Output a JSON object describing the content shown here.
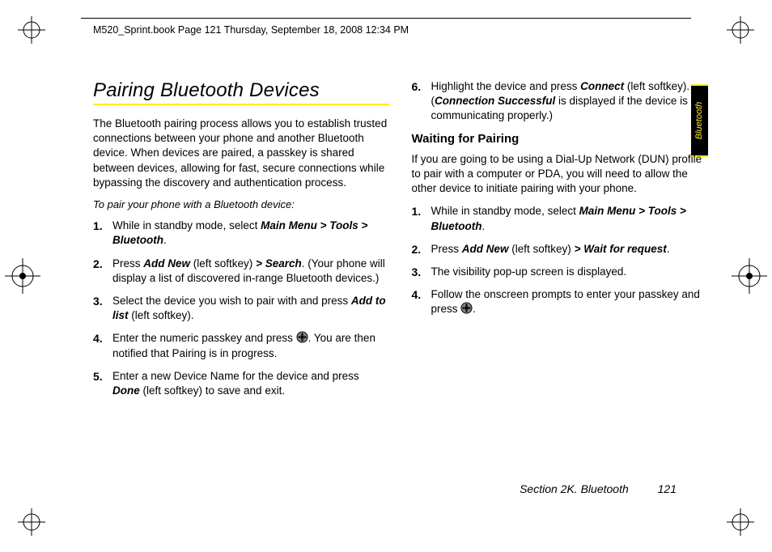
{
  "header": {
    "running": "M520_Sprint.book  Page 121  Thursday, September 18, 2008  12:34 PM"
  },
  "sideTab": {
    "label": "Bluetooth"
  },
  "left": {
    "title": "Pairing Bluetooth Devices",
    "intro": "The Bluetooth pairing process allows you to establish trusted connections between your phone and another Bluetooth device. When devices are paired, a passkey is shared between devices, allowing for fast, secure connections while bypassing the discovery and authentication process.",
    "lead": "To pair your phone with a Bluetooth device:",
    "steps": {
      "s1a": "While in standby mode, select ",
      "s1b": "Main Menu > Tools > Bluetooth",
      "s1c": ".",
      "s2a": "Press ",
      "s2b": "Add New",
      "s2c": " (left softkey) ",
      "s2d": "> Search",
      "s2e": ". (Your phone will display a list of discovered in-range Bluetooth devices.)",
      "s3a": "Select the device you wish to pair with and press ",
      "s3b": "Add to list",
      "s3c": " (left softkey).",
      "s4a": "Enter the numeric passkey and press ",
      "s4b": ". You are then notified that Pairing is in progress.",
      "s5a": "Enter a new Device Name for the device and press ",
      "s5b": "Done",
      "s5c": " (left softkey) to save and exit."
    }
  },
  "right": {
    "s6a": "Highlight the device and press ",
    "s6b": "Connect",
    "s6c": " (left softkey). (",
    "s6d": "Connection Successful",
    "s6e": " is displayed if the device is communicating properly.)",
    "subhead": "Waiting for Pairing",
    "intro": "If you are going to be using a Dial-Up Network (DUN) profile to pair with a computer or PDA, you will need to allow the other device to initiate pairing with your phone.",
    "steps": {
      "s1a": "While in standby mode, select ",
      "s1b": "Main Menu > Tools > Bluetooth",
      "s1c": ".",
      "s2a": "Press ",
      "s2b": " Add New",
      "s2c": " (left softkey) ",
      "s2d": "> Wait for request",
      "s2e": ".",
      "s3": "The visibility pop-up screen is displayed.",
      "s4a": "Follow the onscreen prompts to enter your passkey and press ",
      "s4b": "."
    }
  },
  "footer": {
    "section": "Section 2K. Bluetooth",
    "page": "121"
  },
  "nums": {
    "n1": "1.",
    "n2": "2.",
    "n3": "3.",
    "n4": "4.",
    "n5": "5.",
    "n6": "6."
  }
}
